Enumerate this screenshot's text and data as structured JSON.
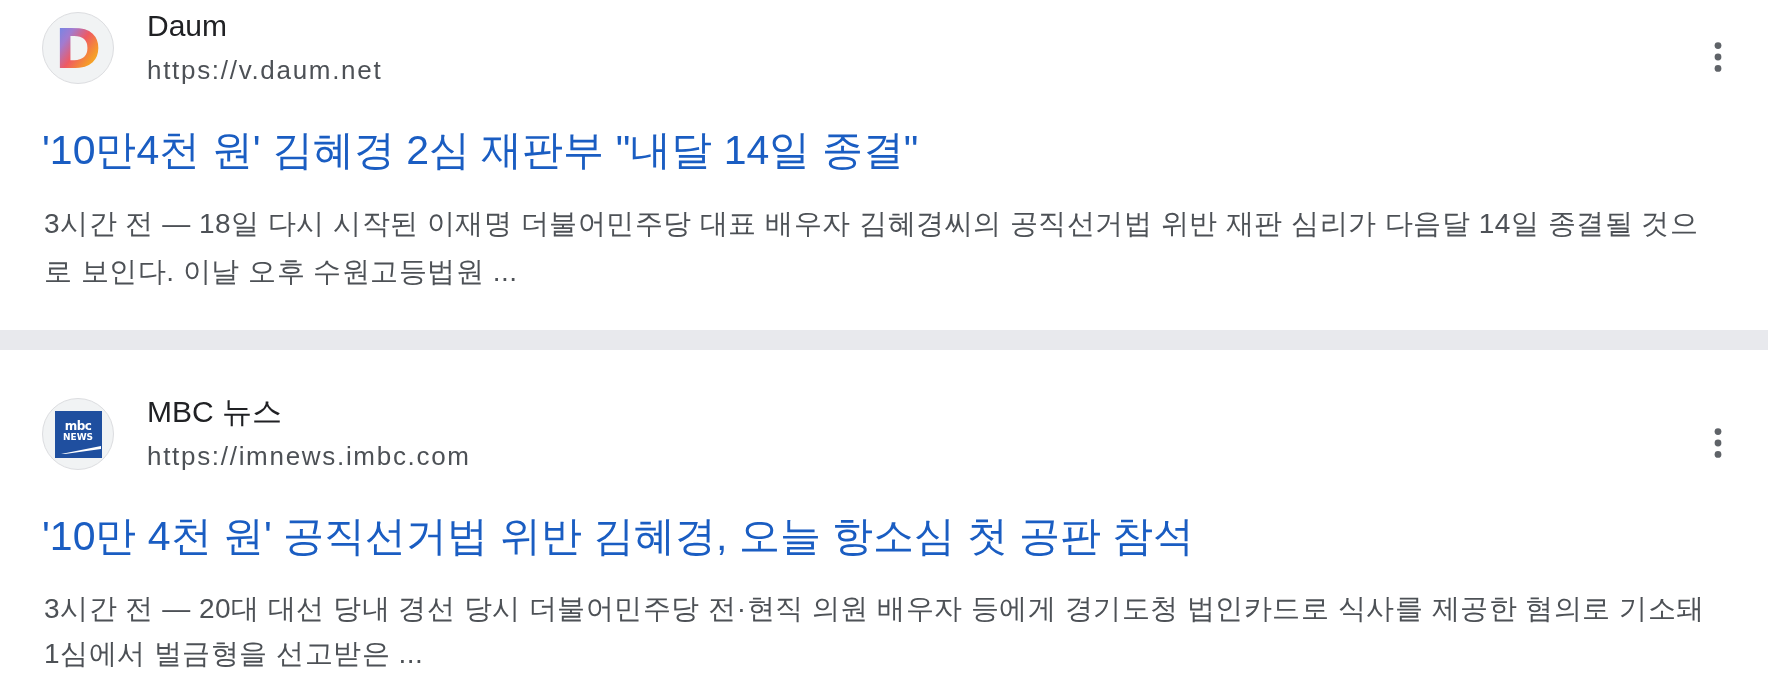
{
  "results": [
    {
      "source": {
        "name": "Daum",
        "url": "https://v.daum.net",
        "logo": {
          "kind": "letter",
          "text": "D"
        }
      },
      "title": "'10만4천 원' 김혜경 2심 재판부 \"내달 14일 종결\"",
      "snippet": "3시간 전 — 18일 다시 시작된 이재명 더불어민주당 대표 배우자 김혜경씨의 공직선거법 위반 재판 심리가 다음달 14일 종결될 것으로 보인다. 이날 오후 수원고등법원 ..."
    },
    {
      "source": {
        "name": "MBC 뉴스",
        "url": "https://imnews.imbc.com",
        "logo": {
          "kind": "tile",
          "lines": [
            "mbc",
            "NEWS"
          ]
        }
      },
      "title": "'10만 4천 원' 공직선거법 위반 김혜경, 오늘 항소심 첫 공판 참석",
      "snippet": "3시간 전 — 20대 대선 당내 경선 당시 더불어민주당 전·현직 의원 배우자 등에게 경기도청 법인카드로 식사를 제공한 혐의로 기소돼 1심에서 벌금형을 선고받은 ..."
    }
  ]
}
